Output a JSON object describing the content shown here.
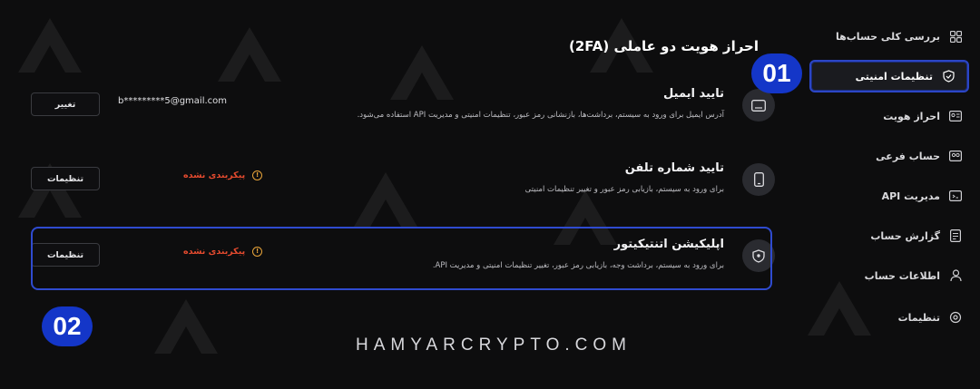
{
  "sidebar": {
    "items": [
      {
        "label": "بررسی کلی حساب‌ها",
        "icon": "grid-icon"
      },
      {
        "label": "تنظیمات امنیتی",
        "icon": "shield-icon",
        "active": true
      },
      {
        "label": "احراز هویت",
        "icon": "id-card-icon"
      },
      {
        "label": "حساب فرعی",
        "icon": "sub-account-icon"
      },
      {
        "label": "مدیریت API",
        "icon": "api-icon"
      },
      {
        "label": "گزارش حساب",
        "icon": "report-icon"
      },
      {
        "label": "اطلاعات حساب",
        "icon": "user-icon"
      },
      {
        "label": "تنظیمات",
        "icon": "settings-icon"
      }
    ]
  },
  "panel": {
    "title": "احراز هویت دو عاملی (2FA)",
    "rows": [
      {
        "title": "تایید ایمیل",
        "description": "آدرس ایمیل برای ورود به سیستم، برداشت‌ها، بازنشانی رمز عبور، تنظیمات امنیتی و مدیریت API استفاده می‌شود.",
        "value": "b*********5@gmail.com",
        "button": "تغییر",
        "icon": "mail-icon"
      },
      {
        "title": "تایید شماره تلفن",
        "description": "برای ورود به سیستم، بازیابی رمز عبور و تغییر تنظیمات امنیتی",
        "status": "پیکربندی نشده",
        "button": "تنظیمات",
        "icon": "phone-icon"
      },
      {
        "title": "اپلیکیشن اتنتیکیتور",
        "description": "برای ورود به سیستم، برداشت وجه، بازیابی رمز عبور، تغییر تنظیمات امنیتی و مدیریت API.",
        "status": "پیکربندی نشده",
        "button": "تنظیمات",
        "icon": "shield-check-icon"
      }
    ]
  },
  "badges": {
    "one": "01",
    "two": "02"
  },
  "footer": {
    "site": "HAMYARCRYPTO.COM"
  },
  "colors": {
    "accent": "#1436c8",
    "status": "#e64b2f",
    "warning": "#e8a43a",
    "background": "#0d0d0e"
  }
}
